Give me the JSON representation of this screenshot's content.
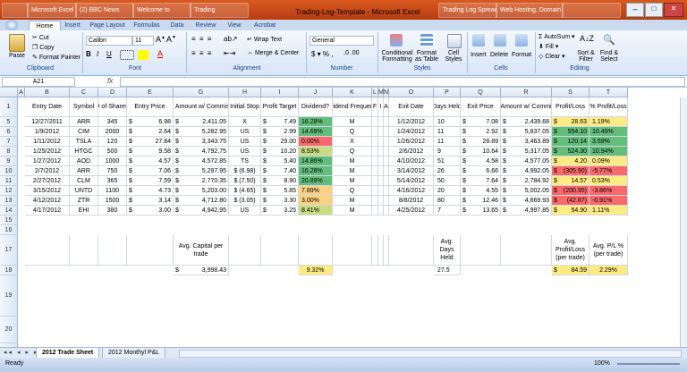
{
  "window": {
    "title": "Trading-Log-Template - Microsoft Excel",
    "taskbar_items": [
      "",
      "Microsoft Excel",
      "(2) BBC News",
      "Welcome to",
      "Trading",
      "Trading-Log-Template",
      "Trading Log Spreadsheet",
      "Web Hosting, Domain N...",
      ""
    ]
  },
  "ribbon": {
    "tabs": [
      "Home",
      "Insert",
      "Page Layout",
      "Formulas",
      "Data",
      "Review",
      "View",
      "Acrobat"
    ],
    "active_tab": "Home",
    "clipboard": {
      "paste": "Paste",
      "cut": "Cut",
      "copy": "Copy",
      "format_painter": "Format Painter",
      "label": "Clipboard"
    },
    "font": {
      "name": "Calibri",
      "size": "11",
      "label": "Font"
    },
    "alignment": {
      "wrap": "Wrap Text",
      "merge": "Merge & Center",
      "label": "Alignment"
    },
    "number": {
      "format": "General",
      "label": "Number"
    },
    "styles": {
      "conditional": "Conditional Formatting",
      "format_table": "Format as Table",
      "cell_styles": "Cell Styles",
      "label": "Styles"
    },
    "cells": {
      "insert": "Insert",
      "delete": "Delete",
      "format": "Format",
      "label": "Cells"
    },
    "editing": {
      "autosum": "AutoSum",
      "fill": "Fill",
      "clear": "Clear",
      "sort": "Sort & Filter",
      "find": "Find & Select",
      "label": "Editing"
    }
  },
  "formula_bar": {
    "name_box": "A21",
    "fx": "fx",
    "value": ""
  },
  "columns": [
    "A",
    "B",
    "C",
    "D",
    "E",
    "F",
    "G",
    "H",
    "I",
    "J",
    "K",
    "L",
    "M",
    "N",
    "O",
    "P",
    "Q",
    "R",
    "S",
    "T"
  ],
  "headers": {
    "B": "Entry Date",
    "C": "Symbol",
    "D": "# of Shares",
    "E": "Entry Price",
    "G": "Total Amount w/ Commission",
    "H": "Initial Stop",
    "I": "Profit Target",
    "J": "Dividend?",
    "K": "Dividend Frequency",
    "L": "F",
    "M": "I",
    "N": "A",
    "O": "Exit Date",
    "P": "Days Held",
    "Q": "Exit Price",
    "R": "Total Amount w/ Commission",
    "S": "Profit/Loss",
    "T": "% Profit/Loss"
  },
  "rows": [
    {
      "n": "5",
      "date": "12/27/2011",
      "sym": "ARR",
      "shares": "345",
      "price": "6.98",
      "total": "2,411.05",
      "stop": "X",
      "target": "7.49",
      "div": "16.28%",
      "freq": "M",
      "exit": "1/12/2012",
      "days": "10",
      "xprice": "7.08",
      "xtotal": "2,439.68",
      "pl": "28.63",
      "pct": "1.19%"
    },
    {
      "n": "6",
      "date": "1/9/2012",
      "sym": "CIM",
      "shares": "2000",
      "price": "2.64",
      "total": "5,282.95",
      "stop": "US",
      "target": "2.99",
      "div": "14.69%",
      "freq": "Q",
      "exit": "1/24/2012",
      "days": "11",
      "xprice": "2.92",
      "xtotal": "5,837.05",
      "pl": "554.10",
      "pct": "10.49%"
    },
    {
      "n": "7",
      "date": "1/11/2012",
      "sym": "TSLA",
      "shares": "120",
      "price": "27.84",
      "total": "3,343.75",
      "stop": "US",
      "target": "29.00",
      "div": "0.00%",
      "freq": "X",
      "exit": "1/26/2012",
      "days": "11",
      "xprice": "28.89",
      "xtotal": "3,463.89",
      "pl": "120.14",
      "pct": "3.59%"
    },
    {
      "n": "8",
      "date": "1/25/2012",
      "sym": "HTGC",
      "shares": "500",
      "price": "9.58",
      "total": "4,792.75",
      "stop": "US",
      "target": "10.20",
      "div": "8.53%",
      "freq": "Q",
      "exit": "2/6/2012",
      "days": "9",
      "xprice": "10.64",
      "xtotal": "5,317.05",
      "pl": "524.30",
      "pct": "10.94%"
    },
    {
      "n": "9",
      "date": "1/27/2012",
      "sym": "AOD",
      "shares": "1000",
      "price": "4.57",
      "total": "4,572.85",
      "stop": "TS",
      "target": "5.40",
      "div": "14.86%",
      "freq": "M",
      "exit": "4/10/2012",
      "days": "51",
      "xprice": "4.58",
      "xtotal": "4,577.05",
      "pl": "4.20",
      "pct": "0.09%"
    },
    {
      "n": "10",
      "date": "2/7/2012",
      "sym": "ARR",
      "shares": "750",
      "price": "7.06",
      "total": "5,297.95",
      "stop": "$ (6.98)",
      "target": "7.40",
      "div": "16.28%",
      "freq": "M",
      "exit": "3/14/2012",
      "days": "26",
      "xprice": "6.66",
      "xtotal": "4,992.05",
      "pl": "(305.90)",
      "pct": "-5.77%"
    },
    {
      "n": "11",
      "date": "2/27/2012",
      "sym": "CLM",
      "shares": "365",
      "price": "7.59",
      "total": "2,770.35",
      "stop": "$ (7.50)",
      "target": "8.90",
      "div": "20.89%",
      "freq": "M",
      "exit": "5/14/2012",
      "days": "50",
      "xprice": "7.64",
      "xtotal": "2,784.92",
      "pl": "14.57",
      "pct": "0.53%"
    },
    {
      "n": "12",
      "date": "3/15/2012",
      "sym": "UNTD",
      "shares": "1100",
      "price": "4.73",
      "total": "5,203.00",
      "stop": "$ (4.65)",
      "target": "5.85",
      "div": "7.89%",
      "freq": "Q",
      "exit": "4/16/2012",
      "days": "20",
      "xprice": "4.55",
      "xtotal": "5,002.05",
      "pl": "(200.95)",
      "pct": "-3.86%"
    },
    {
      "n": "13",
      "date": "4/12/2012",
      "sym": "ZTR",
      "shares": "1500",
      "price": "3.14",
      "total": "4,712.80",
      "stop": "$ (3.05)",
      "target": "3.30",
      "div": "3.00%",
      "freq": "M",
      "exit": "8/8/2012",
      "days": "80",
      "xprice": "12.46",
      "xtotal": "4,669.93",
      "pl": "(42.87)",
      "pct": "-0.91%"
    },
    {
      "n": "14",
      "date": "4/17/2012",
      "sym": "EHI",
      "shares": "380",
      "price": "3.00",
      "total": "4,942.95",
      "stop": "US",
      "target": "3.25",
      "div": "8.41%",
      "freq": "M",
      "exit": "4/25/2012",
      "days": "7",
      "xprice": "13.65",
      "xtotal": "4,997.85",
      "pl": "54.90",
      "pct": "1.11%"
    }
  ],
  "summary": {
    "avg_capital_label": "Avg. Capital per trade",
    "avg_capital_value": "3,998.43",
    "avg_div_value": "9.32%",
    "avg_days_label": "Avg. Days Held",
    "avg_days_value": "27.5",
    "avg_pl_label": "Avg. Profit/Loss (per trade)",
    "avg_pl_value": "84.59",
    "avg_pct_label": "Avg. P/L % (per trade)",
    "avg_pct_value": "2.29%"
  },
  "extra_rows": [
    "15",
    "16",
    "17",
    "18",
    "19",
    "20",
    "21"
  ],
  "sheet_tabs": [
    "2012 Trade Sheet",
    "2012 Monthyl P&L"
  ],
  "active_sheet": "2012 Trade Sheet",
  "status": {
    "ready": "Ready",
    "zoom": "100%"
  },
  "colors": {
    "div_high": "#63be7b",
    "div_mid": "#c9dc81",
    "div_low": "#fed280",
    "div_zero": "#f8696b",
    "pl_pos": "#63be7b",
    "pl_small": "#ffeb84",
    "pl_neg": "#f8696b",
    "summary_yellow": "#ffeb84"
  }
}
